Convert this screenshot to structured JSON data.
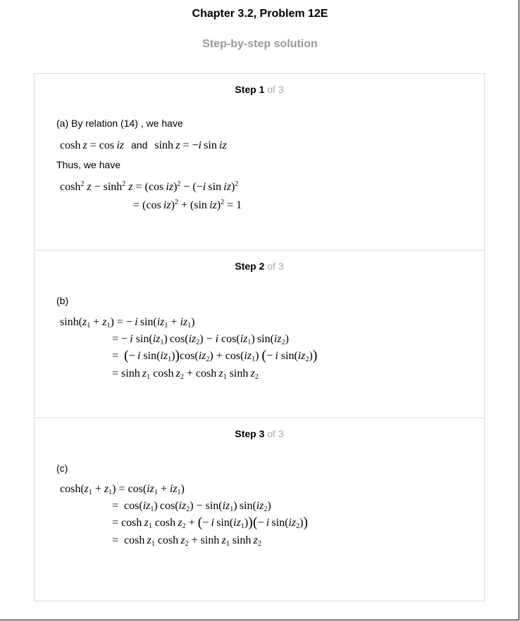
{
  "header": {
    "title": "Chapter 3.2, Problem 12E",
    "subtitle": "Step-by-step solution"
  },
  "steps": [
    {
      "label": "Step 1",
      "of": "of 3",
      "intro": "(a) By relation (14) , we have",
      "connector": "and",
      "middle": "Thus, we have"
    },
    {
      "label": "Step 2",
      "of": "of 3",
      "intro": "(b)"
    },
    {
      "label": "Step 3",
      "of": "of 3",
      "intro": "(c)"
    }
  ]
}
